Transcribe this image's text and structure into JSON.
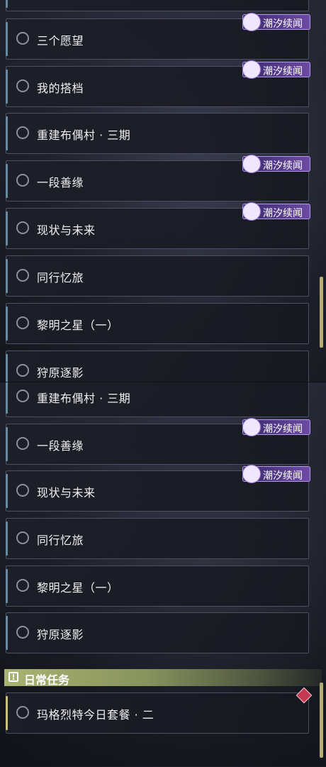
{
  "panel_a": {
    "quests": [
      {
        "label": "三个愿望",
        "badge": "潮汐续闻"
      },
      {
        "label": "我的搭档",
        "badge": "潮汐续闻"
      },
      {
        "label": "重建布偶村 · 三期"
      },
      {
        "label": "一段善缘",
        "badge": "潮汐续闻"
      },
      {
        "label": "现状与未来",
        "badge": "潮汐续闻"
      },
      {
        "label": "同行忆旅"
      },
      {
        "label": "黎明之星（一）"
      },
      {
        "label": "狩原逐影"
      }
    ]
  },
  "panel_b": {
    "quests": [
      {
        "label": "重建布偶村 · 三期"
      },
      {
        "label": "一段善缘",
        "badge": "潮汐续闻"
      },
      {
        "label": "现状与未来",
        "badge": "潮汐续闻"
      },
      {
        "label": "同行忆旅"
      },
      {
        "label": "黎明之星（一）"
      },
      {
        "label": "狩原逐影"
      }
    ],
    "daily_header": "日常任务",
    "daily_quests": [
      {
        "label": "玛格烈特今日套餐 · 二"
      }
    ]
  },
  "icons": {
    "badge_icon": "tidal-feather-icon",
    "daily_icon": "exclamation-box-icon",
    "alert_icon": "alert-diamond-icon"
  }
}
